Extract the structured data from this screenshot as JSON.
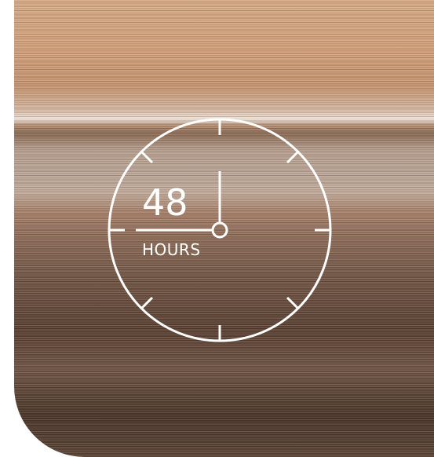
{
  "badge": {
    "value": "48",
    "unit": "HOURS"
  },
  "icon": "clock-icon",
  "colors": {
    "stroke": "#ffffff"
  }
}
